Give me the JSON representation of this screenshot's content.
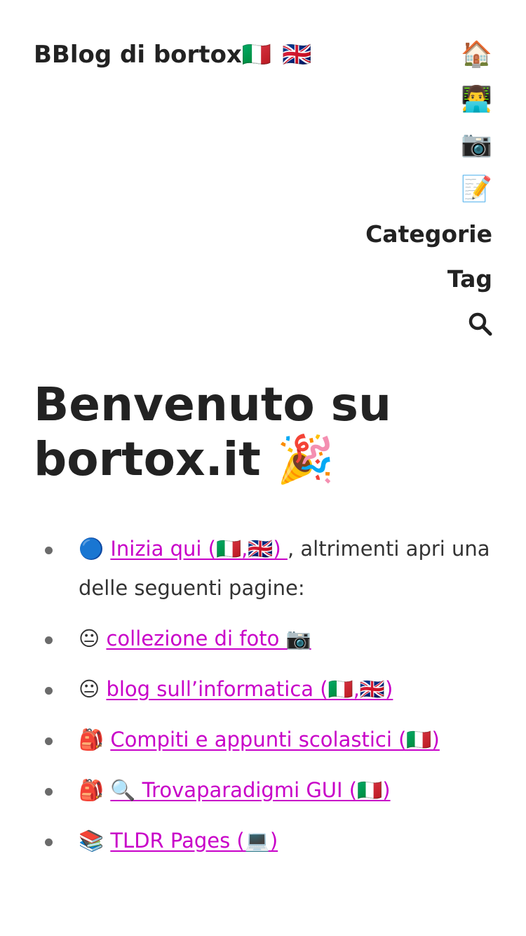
{
  "header": {
    "site_title": "BBlog di bortox",
    "site_title_flags": "🇮🇹 🇬🇧"
  },
  "nav": {
    "items": [
      {
        "label": "🏠",
        "icon": "house-icon"
      },
      {
        "label": "👨‍💻",
        "icon": "technologist-icon"
      },
      {
        "label": "📷",
        "icon": "camera-icon"
      },
      {
        "label": "📝",
        "icon": "memo-icon"
      },
      {
        "label": "Categorie"
      },
      {
        "label": "Tag"
      }
    ],
    "search_icon": "search-icon"
  },
  "main": {
    "heading": "Benvenuto su bortox.it 🎉",
    "links": [
      {
        "prefix": "🔵 ",
        "link": "Inizia qui (🇮🇹,🇬🇧) ",
        "suffix": ", altrimenti apri una delle seguenti pagine:"
      },
      {
        "prefix": "😐 ",
        "link": "collezione di foto 📷",
        "suffix": ""
      },
      {
        "prefix": "😐 ",
        "link": "blog sull’informatica (🇮🇹,🇬🇧)",
        "suffix": ""
      },
      {
        "prefix": "🎒 ",
        "link": "Compiti e appunti scolastici (🇮🇹)",
        "suffix": ""
      },
      {
        "prefix": "🎒 ",
        "link": "🔍 Trovaparadigmi GUI (🇮🇹)",
        "suffix": ""
      },
      {
        "prefix": "📚 ",
        "link": "TLDR Pages (💻)",
        "suffix": ""
      }
    ]
  },
  "colors": {
    "link": "#c800c8",
    "text": "#222222",
    "bullet": "#6b6b6b",
    "background": "#ffffff"
  }
}
